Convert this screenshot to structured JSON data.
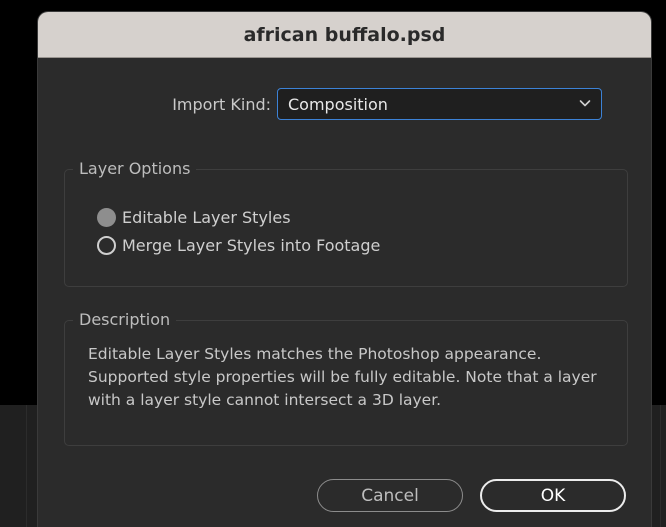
{
  "dialog": {
    "title": "african buffalo.psd",
    "import_kind": {
      "label": "Import Kind:",
      "selected": "Composition"
    },
    "layer_options": {
      "legend": "Layer Options",
      "options": [
        {
          "label": "Editable Layer Styles",
          "selected": true
        },
        {
          "label": "Merge Layer Styles into Footage",
          "selected": false
        }
      ]
    },
    "description": {
      "legend": "Description",
      "text": "Editable Layer Styles matches the Photoshop appearance. Supported style properties will be fully editable. Note that a layer with a layer style cannot intersect a 3D layer."
    },
    "buttons": {
      "cancel": "Cancel",
      "ok": "OK"
    }
  },
  "colors": {
    "accent": "#3c82d6",
    "titlebar": "#d6d1cd",
    "panel": "#2b2b2b"
  }
}
